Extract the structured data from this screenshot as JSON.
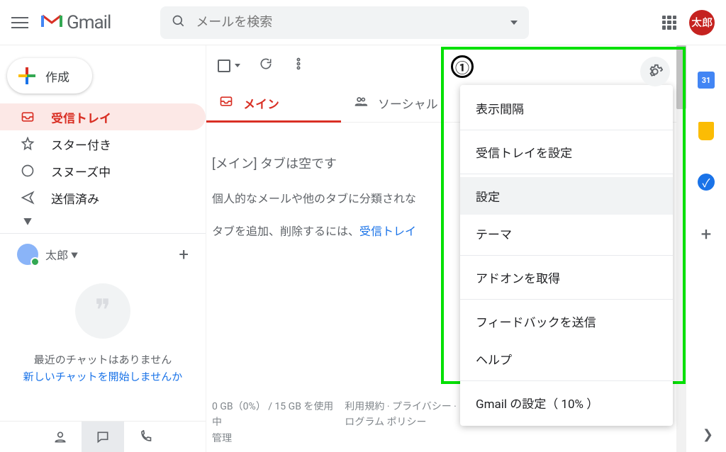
{
  "header": {
    "product_name": "Gmail",
    "search_placeholder": "メールを検索",
    "avatar_label": "太郎"
  },
  "sidebar": {
    "compose_label": "作成",
    "items": [
      {
        "label": "受信トレイ",
        "icon": "inbox-icon",
        "active": true
      },
      {
        "label": "スター付き",
        "icon": "star-icon",
        "active": false
      },
      {
        "label": "スヌーズ中",
        "icon": "clock-icon",
        "active": false
      },
      {
        "label": "送信済み",
        "icon": "send-icon",
        "active": false
      }
    ],
    "hangouts_user": "太郎",
    "hangouts_empty_line1": "最近のチャットはありません",
    "hangouts_empty_link": "新しいチャットを開始しませんか"
  },
  "main": {
    "tabs": [
      {
        "label": "メイン",
        "active": true
      },
      {
        "label": "ソーシャル",
        "active": false
      }
    ],
    "empty_title": "[メイン] タブは空です",
    "empty_subtitle": "個人的なメールや他のタブに分類されな",
    "empty_action_prefix": "タブを追加、削除するには、",
    "empty_action_link": "受信トレイ",
    "storage_line1": "0 GB（0%） / 15 GB を使用",
    "storage_line2": "中",
    "storage_line3": "管理",
    "policy_line1": "利用規約 · プライバシー · プ",
    "policy_line2": "ログラム ポリシー"
  },
  "settings_menu": {
    "items": [
      "表示間隔",
      "受信トレイを設定",
      "設定",
      "テーマ",
      "アドオンを取得",
      "フィードバックを送信",
      "ヘルプ",
      "Gmail の設定（ 10% ）"
    ],
    "highlighted_index": 2
  },
  "sidepanel": {
    "calendar_day": "31"
  },
  "annotation": {
    "label": "①"
  }
}
